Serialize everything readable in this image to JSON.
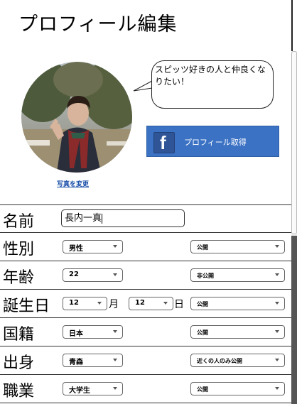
{
  "page": {
    "title": "プロフィール編集"
  },
  "profile": {
    "bubble_text": "スピッツ好きの人と仲良くなりたい！",
    "change_photo_label": "写真を変更",
    "facebook_button_label": "プロフィール取得"
  },
  "form": {
    "name": {
      "label": "名前",
      "value": "長内一真"
    },
    "gender": {
      "label": "性別",
      "value": "男性",
      "visibility": "公開"
    },
    "age": {
      "label": "年齢",
      "value": "22",
      "visibility": "非公開"
    },
    "birthday": {
      "label": "誕生日",
      "month": "12",
      "month_unit": "月",
      "day": "12",
      "day_unit": "日",
      "visibility": "公開"
    },
    "nationality": {
      "label": "国籍",
      "value": "日本",
      "visibility": "公開"
    },
    "hometown": {
      "label": "出身",
      "value": "青森",
      "visibility": "近くの人のみ公開"
    },
    "occupation": {
      "label": "職業",
      "value": "大学生",
      "visibility": "公開"
    }
  },
  "colors": {
    "facebook_blue": "#3b72c4",
    "link_blue": "#1a4fa8"
  }
}
